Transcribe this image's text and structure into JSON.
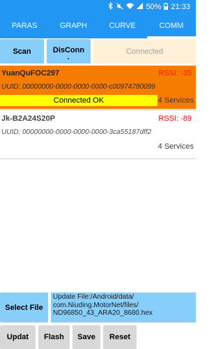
{
  "status": {
    "battery": "50%",
    "time": "21:33"
  },
  "tabs": [
    "PARAS",
    "GRAPH",
    "CURVE",
    "COMM"
  ],
  "active_tab": "COMM",
  "toolbar": {
    "scan": "Scan",
    "disconnect": "DisConn",
    "connection_status": "Connected"
  },
  "devices": [
    {
      "name": "YuanQuFOC297",
      "rssi": "RSSI: -35",
      "uuid": "UUID: 00000000-0000-0000-0000-c00974780099",
      "state": "Connected OK",
      "services": "4 Services"
    },
    {
      "name": "Jk-B2A24S20P",
      "rssi": "RSSI: -89",
      "uuid": "UUID: 00000000-0000-0000-0000-3ca55187dff2",
      "services": "4 Services"
    }
  ],
  "update": {
    "select_file": "Select File",
    "file_lines": [
      "Update File:/Android/data/",
      "com.Niuding.MotorNet/files/",
      "ND96850_43_ARA20_8680.hex"
    ]
  },
  "actions": {
    "update": "Updat",
    "flash": "Flash",
    "save": "Save",
    "reset": "Reset"
  },
  "colors": {
    "primary": "#2196f3",
    "selected_device": "#f57c00",
    "connected_badge": "#ffff00",
    "button": "#87cefa",
    "rssi": "#ff0000"
  },
  "icons": [
    "bluetooth-icon",
    "mute-icon",
    "wifi-icon",
    "signal-icon",
    "battery-icon"
  ]
}
